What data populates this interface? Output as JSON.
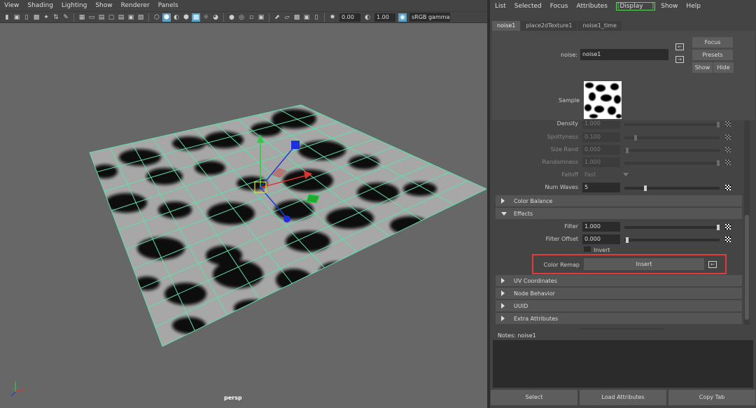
{
  "viewport": {
    "menu": [
      "View",
      "Shading",
      "Lighting",
      "Show",
      "Renderer",
      "Panels"
    ],
    "toolbar": {
      "field_a": "0.00",
      "field_b": "1.00",
      "color_space": "sRGB gamma"
    },
    "camera_label": "persp"
  },
  "attribute_editor": {
    "menu": [
      "List",
      "Selected",
      "Focus",
      "Attributes",
      "Display",
      "Show",
      "Help"
    ],
    "tabs": [
      "noise1",
      "place2dTexture1",
      "noise1_time"
    ],
    "active_tab": "noise1",
    "node_type_label": "noise:",
    "node_name": "noise1",
    "buttons": {
      "focus": "Focus",
      "presets": "Presets",
      "show": "Show",
      "hide": "Hide"
    },
    "sample_label": "Sample",
    "attributes": {
      "density": {
        "label": "Density",
        "value": "1.000",
        "slider": 1.0,
        "enabled": false
      },
      "spottyness": {
        "label": "Spottyness",
        "value": "0.100",
        "slider": 0.1,
        "enabled": false
      },
      "size_rand": {
        "label": "Size Rand",
        "value": "0.000",
        "slider": 0.0,
        "enabled": false
      },
      "randomness": {
        "label": "Randomness",
        "value": "1.000",
        "slider": 1.0,
        "enabled": false
      },
      "falloff": {
        "label": "Falloff",
        "value": "Fast",
        "enabled": false
      },
      "num_waves": {
        "label": "Num Waves",
        "value": "5",
        "slider": 0.18,
        "enabled": true
      },
      "filter": {
        "label": "Filter",
        "value": "1.000",
        "slider": 1.0,
        "enabled": true
      },
      "filter_offset": {
        "label": "Filter Offset",
        "value": "0.000",
        "slider": 0.0,
        "enabled": true
      },
      "invert": {
        "label": "Invert",
        "checked": false
      },
      "color_remap": {
        "label": "Color Remap",
        "button": "Insert"
      }
    },
    "sections": {
      "color_balance": "Color Balance",
      "effects": "Effects",
      "uv_coordinates": "UV Coordinates",
      "node_behavior": "Node Behavior",
      "uuid": "UUID",
      "extra_attributes": "Extra Attributes"
    },
    "notes_label": "Notes:  noise1",
    "bottom_buttons": {
      "select": "Select",
      "load_attributes": "Load Attributes",
      "copy_tab": "Copy Tab"
    }
  },
  "colors": {
    "grid_line": "#5fe0a8",
    "highlight_box": "#e23b3b",
    "active_menu": "#5fd35f",
    "active_icon": "#5aa3c6"
  }
}
